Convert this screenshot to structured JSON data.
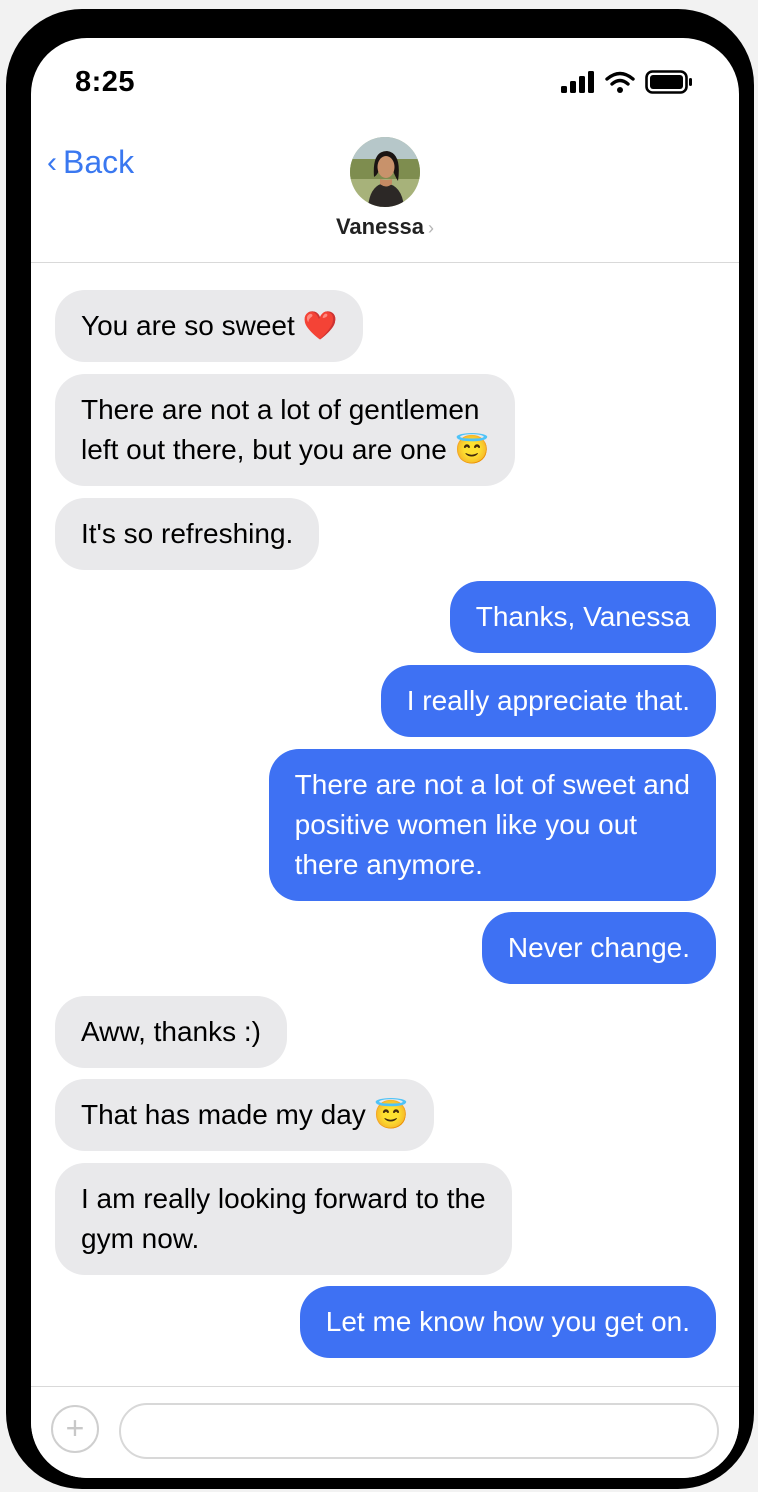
{
  "status_bar": {
    "time": "8:25",
    "signal_icon": "cellular-signal-icon",
    "wifi_icon": "wifi-icon",
    "battery_icon": "battery-icon"
  },
  "header": {
    "back_label": "Back",
    "back_chevron": "‹",
    "contact_name": "Vanessa",
    "contact_chevron": "›"
  },
  "messages": [
    {
      "direction": "incoming",
      "text": "You are so sweet ❤️"
    },
    {
      "direction": "incoming",
      "text": "There are not a lot of gentlemen\nleft out there, but you are one 😇"
    },
    {
      "direction": "incoming",
      "text": "It's so refreshing."
    },
    {
      "direction": "outgoing",
      "text": "Thanks, Vanessa"
    },
    {
      "direction": "outgoing",
      "text": "I really appreciate that."
    },
    {
      "direction": "outgoing",
      "text": "There are not a lot of sweet and\npositive women like you out\nthere anymore."
    },
    {
      "direction": "outgoing",
      "text": "Never change."
    },
    {
      "direction": "incoming",
      "text": "Aww, thanks :)"
    },
    {
      "direction": "incoming",
      "text": "That has made my day 😇"
    },
    {
      "direction": "incoming",
      "text": "I am really looking forward to the\ngym now."
    },
    {
      "direction": "outgoing",
      "text": "Let me know how you get on."
    }
  ],
  "composer": {
    "plus_symbol": "+",
    "input_value": "",
    "input_placeholder": ""
  },
  "colors": {
    "outgoing_bubble": "#3e71f3",
    "incoming_bubble": "#e9e9eb",
    "accent": "#3a78f0"
  }
}
